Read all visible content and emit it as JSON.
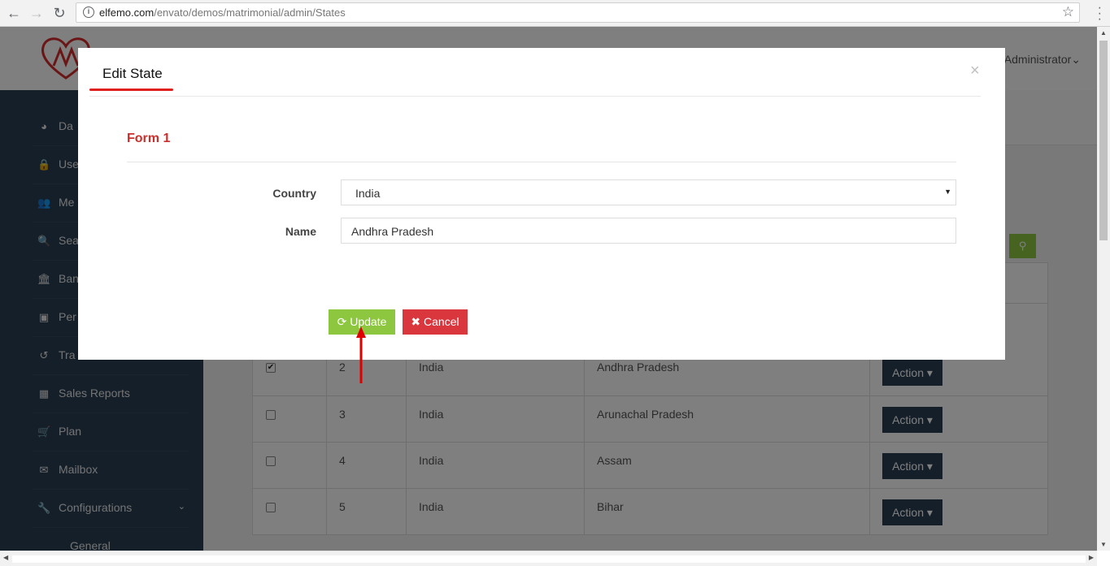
{
  "browser": {
    "url_host": "elfemo.com",
    "url_path": "/envato/demos/matrimonial/admin/States"
  },
  "header": {
    "user_label": "Administrator"
  },
  "sidebar": {
    "items": [
      {
        "label": "Da",
        "icon": "dashboard-icon",
        "glyph": "◕"
      },
      {
        "label": "Use",
        "icon": "lock-icon",
        "glyph": "🔒"
      },
      {
        "label": "Me",
        "icon": "users-icon",
        "glyph": "👥"
      },
      {
        "label": "Sea",
        "icon": "search-icon",
        "glyph": "🔍"
      },
      {
        "label": "Ban",
        "icon": "bank-icon",
        "glyph": "🏛"
      },
      {
        "label": "Per",
        "icon": "image-icon",
        "glyph": "▣"
      },
      {
        "label": "Tra",
        "icon": "history-icon",
        "glyph": "↺"
      },
      {
        "label": "Sales Reports",
        "icon": "table-icon",
        "glyph": "▦"
      },
      {
        "label": "Plan",
        "icon": "cart-icon",
        "glyph": "🛒"
      },
      {
        "label": "Mailbox",
        "icon": "envelope-icon",
        "glyph": "✉"
      },
      {
        "label": "Configurations",
        "icon": "wrench-icon",
        "glyph": "🔧"
      },
      {
        "label": "General",
        "icon": "",
        "glyph": ""
      }
    ]
  },
  "table": {
    "rows": [
      {
        "checked": true,
        "id": "2",
        "country": "India",
        "state": "Andhra Pradesh",
        "action": "Action"
      },
      {
        "checked": false,
        "id": "3",
        "country": "India",
        "state": "Arunachal Pradesh",
        "action": "Action"
      },
      {
        "checked": false,
        "id": "4",
        "country": "India",
        "state": "Assam",
        "action": "Action"
      },
      {
        "checked": false,
        "id": "5",
        "country": "India",
        "state": "Bihar",
        "action": "Action"
      }
    ]
  },
  "modal": {
    "title": "Edit State",
    "close": "×",
    "form_title": "Form 1",
    "country_label": "Country",
    "country_value": "India",
    "name_label": "Name",
    "name_value": "Andhra Pradesh",
    "update_label": "Update",
    "cancel_label": "Cancel"
  },
  "colors": {
    "sidebar": "#2a3f54",
    "update_button": "#8dc63f",
    "cancel_button": "#d9363e",
    "form_title": "#c9302c",
    "annotation": "#e00000"
  }
}
